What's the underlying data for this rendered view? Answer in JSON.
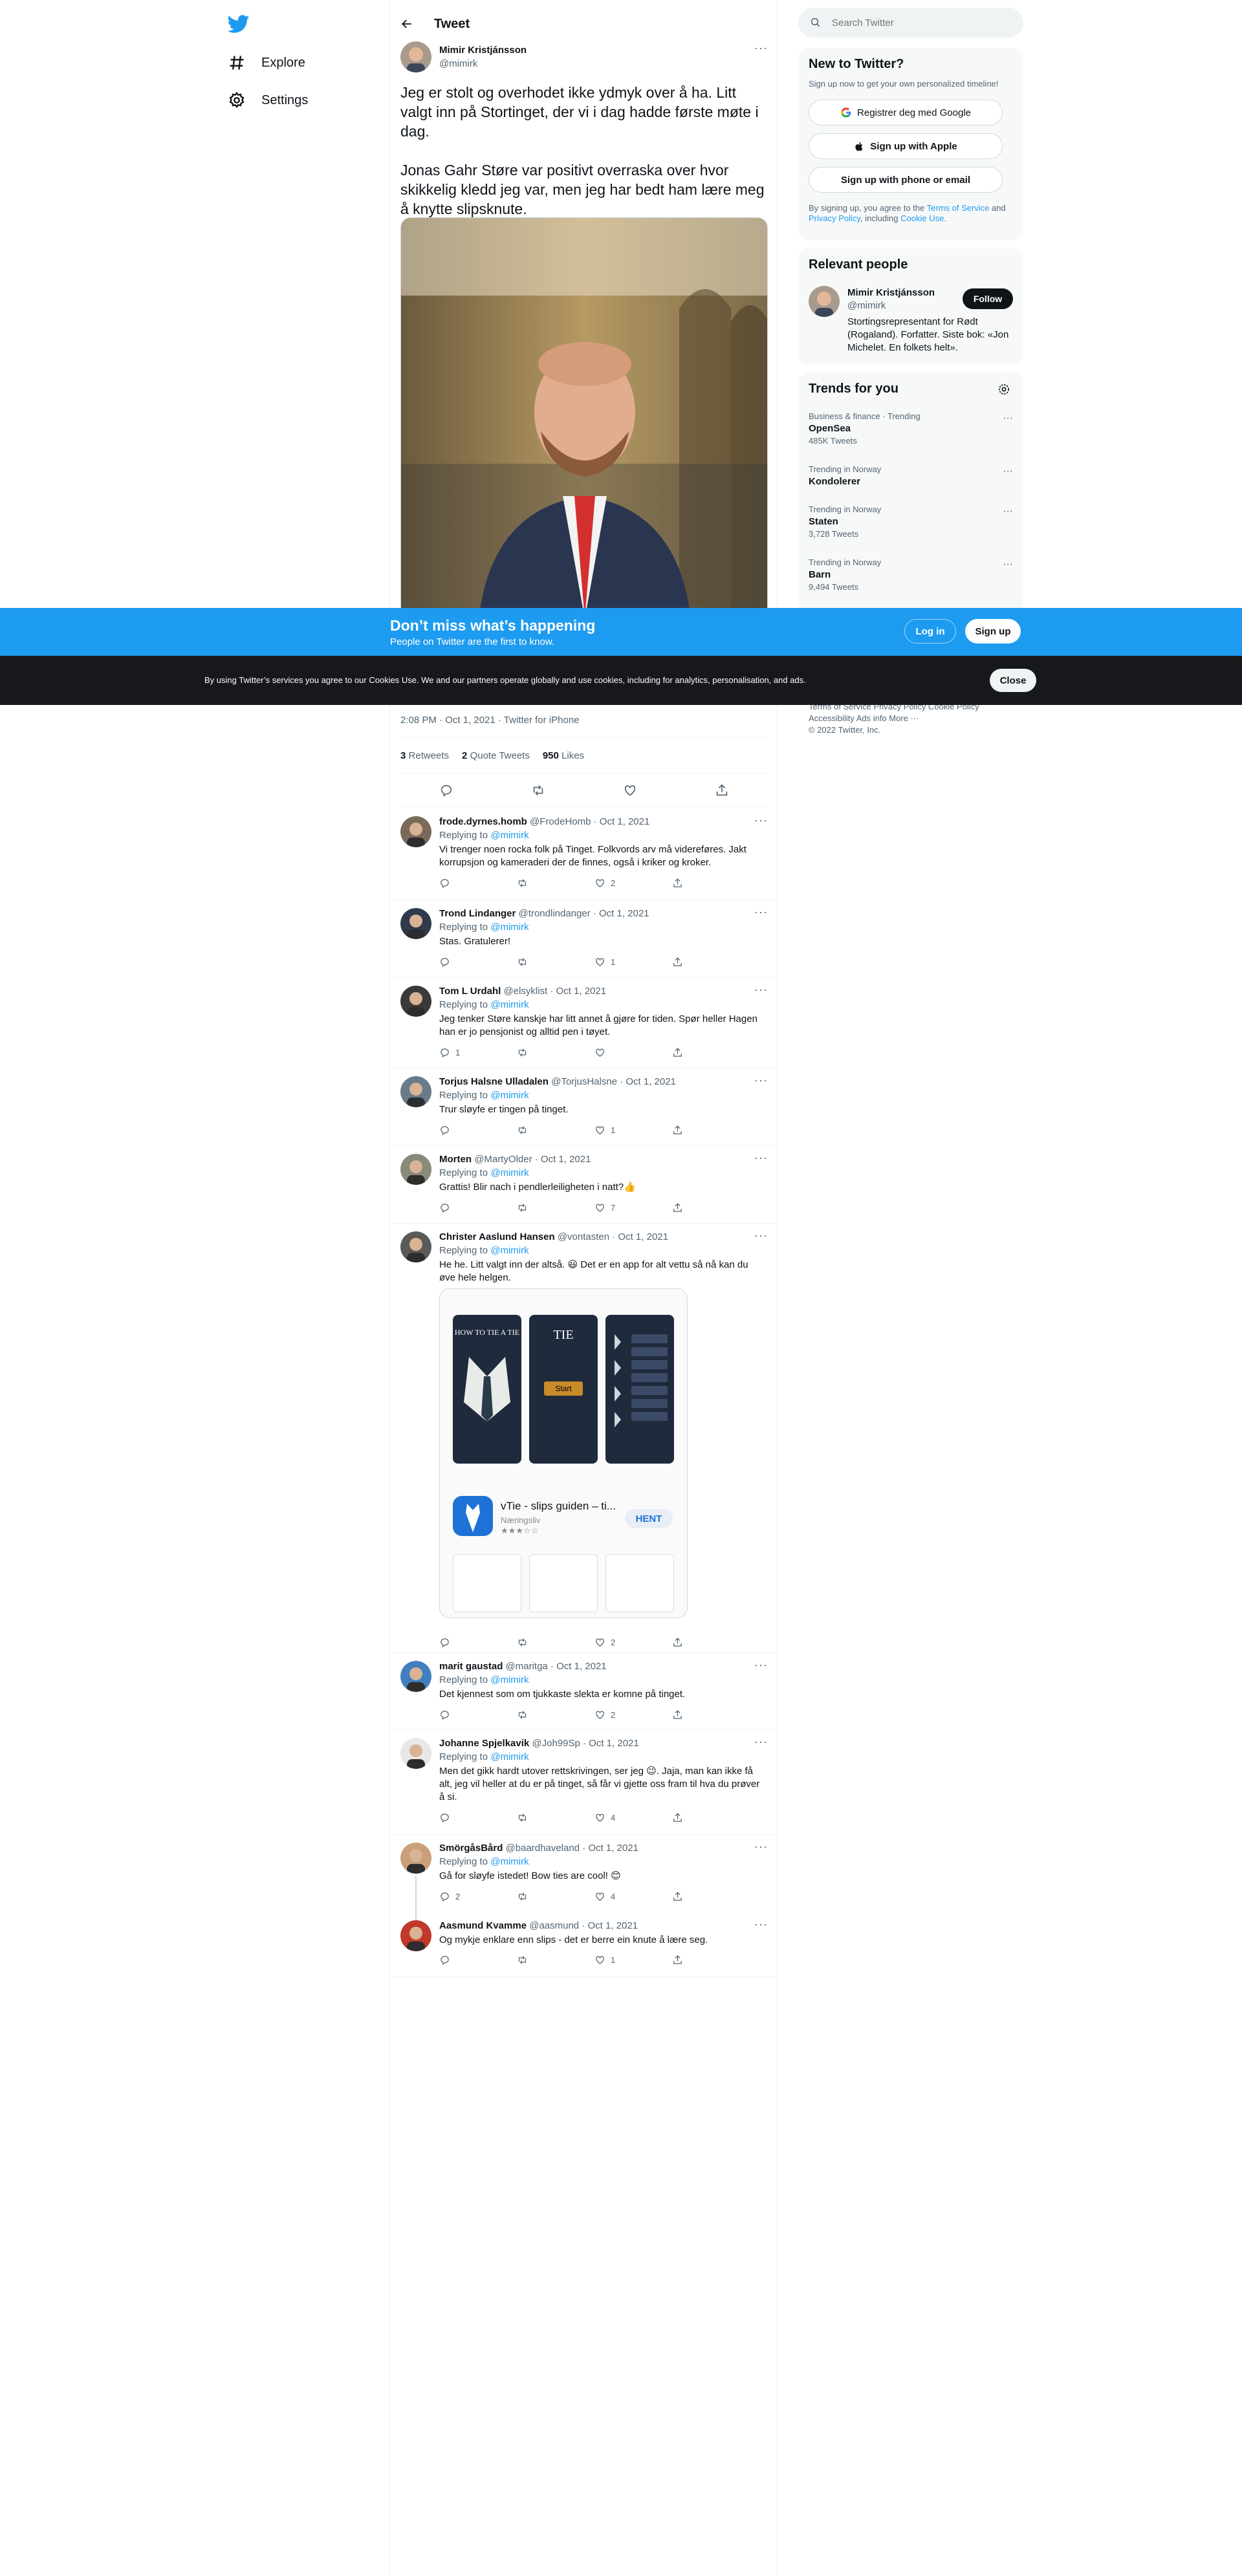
{
  "nav": {
    "explore": "Explore",
    "settings": "Settings"
  },
  "header": {
    "title": "Tweet"
  },
  "tweet": {
    "author_name": "Mimir Kristjánsson",
    "author_handle": "@mimirk",
    "text": "Jeg er stolt og overhodet ikke ydmyk over å ha. Litt valgt inn på Stortinget, der vi i dag hadde første møte i dag.\n\nJonas Gahr Støre var positivt overraska over hvor skikkelig kledd jeg var, men jeg har bedt ham lære meg å knytte slipsknute.",
    "timestamp": "2:08 PM · Oct 1, 2021 · Twitter for iPhone",
    "retweets": "3",
    "retweets_label": "Retweets",
    "quotes": "2",
    "quotes_label": "Quote Tweets",
    "likes": "950",
    "likes_label": "Likes"
  },
  "replies": [
    {
      "name": "frode.dyrnes.homb",
      "handle": "@FrodeHomb · Oct 1, 2021",
      "replying": "Replying to",
      "mention": "@mimirk",
      "text": "Vi trenger noen rocka folk på Tinget. Folkvords arv må videreføres. Jakt korrupsjon og kameraderi der de finnes, også i kriker og kroker.",
      "reply_count": "",
      "rt_count": "",
      "like_count": "2"
    },
    {
      "name": "Trond Lindanger",
      "handle": "@trondlindanger · Oct 1, 2021",
      "replying": "Replying to",
      "mention": "@mimirk",
      "text": "Stas. Gratulerer!",
      "reply_count": "",
      "rt_count": "",
      "like_count": "1"
    },
    {
      "name": "Tom L Urdahl",
      "handle": "@elsyklist · Oct 1, 2021",
      "replying": "Replying to",
      "mention": "@mimirk",
      "text": "Jeg tenker Støre kanskje har litt annet å gjøre for tiden. Spør heller Hagen han er jo pensjonist og alltid pen i tøyet.",
      "reply_count": "1",
      "rt_count": "",
      "like_count": ""
    },
    {
      "name": "Torjus Halsne Ulladalen",
      "handle": "@TorjusHalsne · Oct 1, 2021",
      "replying": "Replying to",
      "mention": "@mimirk",
      "text": "Trur sløyfe er tingen på tinget.",
      "reply_count": "",
      "rt_count": "",
      "like_count": "1"
    },
    {
      "name": "Morten",
      "handle": "@MartyOlder · Oct 1, 2021",
      "replying": "Replying to",
      "mention": "@mimirk",
      "text": "Grattis! Blir nach i pendlerleiligheten i natt?👍",
      "reply_count": "",
      "rt_count": "",
      "like_count": "7"
    },
    {
      "name": "Christer Aaslund Hansen",
      "handle": "@vontasten · Oct 1, 2021",
      "replying": "Replying to",
      "mention": "@mimirk",
      "text": "He he. Litt valgt inn der altså. 😃 Det er en app for alt vettu så nå kan du øve hele helgen.",
      "reply_count": "",
      "rt_count": "",
      "like_count": "2"
    },
    {
      "name": "marit gaustad",
      "handle": "@maritga · Oct 1, 2021",
      "replying": "Replying to",
      "mention": "@mimirk",
      "text": "Det kjennest som om tjukkaste slekta er komne på tinget.",
      "reply_count": "",
      "rt_count": "",
      "like_count": "2"
    },
    {
      "name": "Johanne Spjelkavik",
      "handle": "@Joh99Sp · Oct 1, 2021",
      "replying": "Replying to",
      "mention": "@mimirk",
      "text": "Men det gikk hardt utover rettskrivingen, ser jeg 😉. Jaja, man kan ikke få alt, jeg vil heller at du er på tinget, så får vi gjette oss fram til hva du prøver å si.",
      "reply_count": "",
      "rt_count": "",
      "like_count": "4"
    },
    {
      "name": "SmörgåsBård",
      "handle": "@baardhaveland · Oct 1, 2021",
      "replying": "Replying to",
      "mention": "@mimirk",
      "text": "Gå for sløyfe istedet! Bow ties are cool! 😊",
      "reply_count": "2",
      "rt_count": "",
      "like_count": "4"
    },
    {
      "name": "Aasmund Kvamme",
      "handle": "@aasmund · Oct 1, 2021",
      "replying": "",
      "mention": "",
      "text": "Og mykje enklare enn slips - det er berre ein knute å lære seg.",
      "reply_count": "",
      "rt_count": "",
      "like_count": "1"
    }
  ],
  "appcard": {
    "screen1_title": "HOW TO TIE A TIE",
    "screen2_title": "TIE",
    "screen2_button": "Start",
    "app_name": "vTie - slips guiden – ti...",
    "app_category": "Næringsliv",
    "get_button": "HENT"
  },
  "right": {
    "search_placeholder": "Search Twitter",
    "new_title": "New to Twitter?",
    "new_sub": "Sign up now to get your own personalized timeline!",
    "btn_google": "Registrer deg med Google",
    "btn_apple": "Sign up with Apple",
    "btn_phone": "Sign up with phone or email",
    "legal_1": "By signing up, you agree to the ",
    "legal_tos": "Terms of Service",
    "legal_2": " and ",
    "legal_pp": "Privacy Policy",
    "legal_3": ", including ",
    "legal_cu": "Cookie Use",
    "legal_4": ".",
    "relevant_title": "Relevant people",
    "rel_name": "Mimir Kristjánsson",
    "rel_handle": "@mimirk",
    "rel_follow": "Follow",
    "rel_bio": "Stortingsrepresentant for Rødt (Rogaland). Forfatter. Siste bok: «Jon Michelet. En folkets helt».",
    "trends_title": "Trends for you",
    "trends": [
      {
        "cat": "Business & finance · Trending",
        "name": "OpenSea",
        "count": "485K Tweets"
      },
      {
        "cat": "Trending in Norway",
        "name": "Kondolerer",
        "count": ""
      },
      {
        "cat": "Trending in Norway",
        "name": "Staten",
        "count": "3,728 Tweets"
      },
      {
        "cat": "Trending in Norway",
        "name": "Barn",
        "count": "9,494 Tweets"
      }
    ],
    "footer_line1": "Terms of Service   Privacy Policy   Cookie Policy",
    "footer_line2": "Accessibility   Ads info   More ···",
    "footer_line3": "© 2022 Twitter, Inc."
  },
  "banner": {
    "headline": "Don’t miss what’s happening",
    "sub": "People on Twitter are the first to know.",
    "login": "Log in",
    "signup": "Sign up"
  },
  "cookie": {
    "text": "By using Twitter’s services you agree to our Cookies Use. We and our partners operate globally and use cookies, including for analytics, personalisation, and ads.",
    "close": "Close"
  },
  "colors": {
    "accent": "#1d9bf0",
    "dark": "#0f1419",
    "muted": "#536471",
    "cookie_bg": "#16181c"
  }
}
